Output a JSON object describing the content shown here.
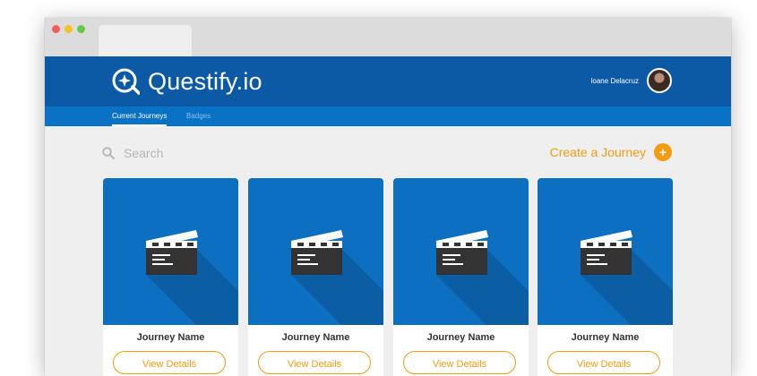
{
  "app": {
    "name": "Questify.io"
  },
  "user": {
    "name": "Ioane Delacruz"
  },
  "nav": {
    "tabs": [
      {
        "label": "Current Journeys"
      },
      {
        "label": "Badges"
      }
    ]
  },
  "search": {
    "placeholder": "Search"
  },
  "actions": {
    "create_label": "Create a Journey",
    "create_icon": "+"
  },
  "cards": [
    {
      "title": "Journey Name",
      "button": "View Details"
    },
    {
      "title": "Journey Name",
      "button": "View Details"
    },
    {
      "title": "Journey Name",
      "button": "View Details"
    },
    {
      "title": "Journey Name",
      "button": "View Details"
    }
  ],
  "colors": {
    "header": "#0c5aa6",
    "subnav": "#0a72c4",
    "card_image": "#0c6fc0",
    "accent": "#f39c12",
    "background": "#efefef"
  }
}
